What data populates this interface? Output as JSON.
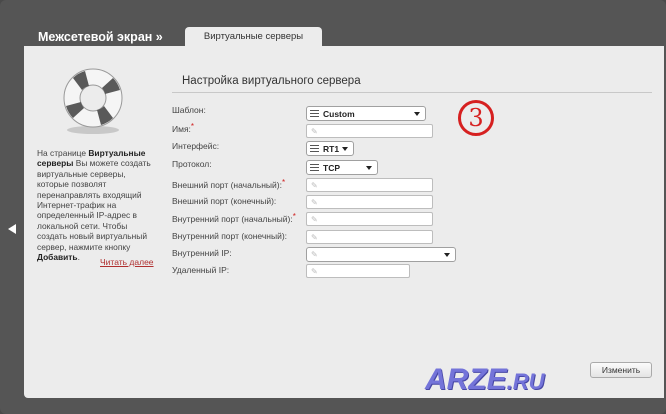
{
  "header": {
    "title": "Межсетевой экран »",
    "tab_label": "Виртуальные серверы"
  },
  "sidebar": {
    "icon": "lifebuoy-icon",
    "desc_part1": "На странице ",
    "desc_bold1": "Виртуальные серверы",
    "desc_part2": " Вы можете создать виртуальные серверы, которые позволят перенаправлять входящий Интернет-трафик на определенный IP-адрес в локальной сети. Чтобы создать новый виртуальный сервер, нажмите кнопку ",
    "desc_bold2": "Добавить",
    "desc_end": ".",
    "read_more": "Читать далее"
  },
  "form": {
    "section_title": "Настройка виртуального сервера",
    "template_label": "Шаблон:",
    "template_value": "Custom",
    "name_label": "Имя:",
    "interface_label": "Интерфейс:",
    "interface_value": "RT1",
    "protocol_label": "Протокол:",
    "protocol_value": "TCP",
    "ext_port_start_label": "Внешний порт (начальный):",
    "ext_port_end_label": "Внешний порт (конечный):",
    "int_port_start_label": "Внутренний порт (начальный):",
    "int_port_end_label": "Внутренний порт (конечный):",
    "internal_ip_label": "Внутренний IP:",
    "remote_ip_label": "Удаленный IP:",
    "required_mark": "*"
  },
  "annotation": {
    "step_number": "3",
    "color": "#d62020"
  },
  "actions": {
    "apply_label": "Изменить"
  },
  "watermark": {
    "main": "ARZE",
    "suffix": ".RU"
  }
}
